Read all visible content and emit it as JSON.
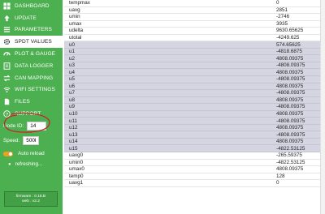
{
  "nav": [
    {
      "label": "DASHBOARD",
      "icon": "dashboard-icon"
    },
    {
      "label": "UPDATE",
      "icon": "upload-icon"
    },
    {
      "label": "PARAMETERS",
      "icon": "list-icon"
    },
    {
      "label": "SPDT VALUES",
      "icon": "gear-icon"
    },
    {
      "label": "PLOT & GAUGE",
      "icon": "gauge-icon"
    },
    {
      "label": "DATA LOGGER",
      "icon": "logger-icon"
    },
    {
      "label": "CAN MAPPING",
      "icon": "swap-icon"
    },
    {
      "label": "WIFI SETTINGS",
      "icon": "wifi-icon"
    },
    {
      "label": "FILES",
      "icon": "file-icon"
    },
    {
      "label": "SUPPORT",
      "icon": "help-icon"
    }
  ],
  "node_id": {
    "label": "Node ID:",
    "value": "14"
  },
  "speed": {
    "label": "Speed:",
    "value": "500k"
  },
  "auto_reload": {
    "label": "Auto reload"
  },
  "refreshing": {
    "label": "refreshing..."
  },
  "firmware": {
    "firmware_line": "firmware  : 0.18.B",
    "web_line": "web : v2.2"
  },
  "table_rows": [
    {
      "key": "tempmax",
      "value": "0",
      "highlight": false
    },
    {
      "key": "uavg",
      "value": "2851",
      "highlight": false
    },
    {
      "key": "umin",
      "value": "-2746",
      "highlight": false
    },
    {
      "key": "umax",
      "value": "3935",
      "highlight": false
    },
    {
      "key": "udelta",
      "value": "9630.65625",
      "highlight": false
    },
    {
      "key": "utotal",
      "value": "-4249.625",
      "highlight": false
    },
    {
      "key": "u0",
      "value": "574.65625",
      "highlight": true
    },
    {
      "key": "u1",
      "value": "-4818.6875",
      "highlight": true
    },
    {
      "key": "u2",
      "value": "4808.09375",
      "highlight": true
    },
    {
      "key": "u3",
      "value": "-4808.09375",
      "highlight": true
    },
    {
      "key": "u4",
      "value": "4808.09375",
      "highlight": true
    },
    {
      "key": "u5",
      "value": "-4808.09375",
      "highlight": true
    },
    {
      "key": "u6",
      "value": "4808.09375",
      "highlight": true
    },
    {
      "key": "u7",
      "value": "-4808.09375",
      "highlight": true
    },
    {
      "key": "u8",
      "value": "4808.09375",
      "highlight": true
    },
    {
      "key": "u9",
      "value": "-4808.09375",
      "highlight": true
    },
    {
      "key": "u10",
      "value": "4808.09375",
      "highlight": true
    },
    {
      "key": "u11",
      "value": "-4808.09375",
      "highlight": true
    },
    {
      "key": "u12",
      "value": "4808.09375",
      "highlight": true
    },
    {
      "key": "u13",
      "value": "-4808.09375",
      "highlight": true
    },
    {
      "key": "u14",
      "value": "4808.09375",
      "highlight": true
    },
    {
      "key": "u15",
      "value": "-4822.53125",
      "highlight": true
    },
    {
      "key": "uavg0",
      "value": "-265.59375",
      "highlight": false
    },
    {
      "key": "umin0",
      "value": "-4822.53125",
      "highlight": false
    },
    {
      "key": "umax0",
      "value": "4808.09375",
      "highlight": false
    },
    {
      "key": "temp0",
      "value": "128",
      "highlight": false
    },
    {
      "key": "uavg1",
      "value": "0",
      "highlight": false
    }
  ],
  "colors": {
    "sidebar": "#4caf50",
    "highlight_row": "#d5d5e2",
    "annotation": "#c62828",
    "toggle": "#f0a020"
  }
}
